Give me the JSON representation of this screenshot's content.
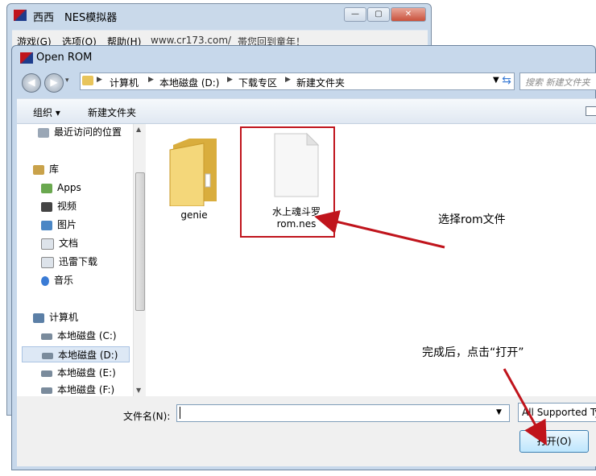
{
  "colors": {
    "annotation_red": "#c0141c",
    "folder": "#e8c45a",
    "accent": "#3a7bd5"
  },
  "emulator": {
    "title": "西西　NES模拟器",
    "menu": [
      "游戏(G)",
      "选项(O)",
      "帮助(H)",
      "www.cr173.com/",
      "帯您回到童年！"
    ]
  },
  "dialog": {
    "title": "Open ROM",
    "breadcrumb": [
      "计算机",
      "本地磁盘 (D:)",
      "下载专区",
      "新建文件夹"
    ],
    "search_placeholder": "搜索 新建文件夹",
    "toolbar": {
      "organize": "组织 ▾",
      "new_folder": "新建文件夹"
    },
    "nav": {
      "recent": "最近访问的位置",
      "libraries": "库",
      "library_items": [
        "Apps",
        "视频",
        "图片",
        "文档",
        "迅雷下载",
        "音乐"
      ],
      "computer": "计算机",
      "drives": [
        "本地磁盘 (C:)",
        "本地磁盘 (D:)",
        "本地磁盘 (E:)",
        "本地磁盘 (F:)"
      ]
    },
    "files": [
      {
        "name": "genie",
        "icon": "folder-icon"
      },
      {
        "name_line1": "水上魂斗罗",
        "name_line2": "rom.nes",
        "icon": "file-icon"
      }
    ],
    "filename_label": "文件名(N):",
    "filename_value": "",
    "filetype": "All Supported Types",
    "open_button": "打开(O)"
  },
  "annotations": {
    "select_rom": "选择rom文件",
    "after_done": "完成后，点击“打开”"
  }
}
